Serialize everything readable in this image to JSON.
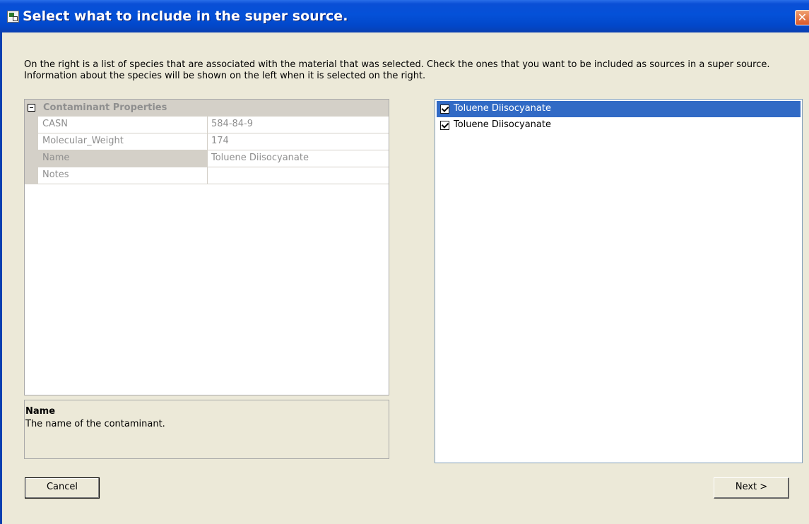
{
  "window": {
    "title": "Select what to include in the super source.",
    "close_glyph": "✕"
  },
  "instructions": "On the right is a list of species that are associated with the material that was selected.  Check the ones that you want to be included as sources in a super source.  Information about the species will be shown on the left when it is selected on the right.",
  "property_grid": {
    "category": "Contaminant Properties",
    "rows": [
      {
        "name": "CASN",
        "value": "584-84-9"
      },
      {
        "name": "Molecular_Weight",
        "value": "174"
      },
      {
        "name": "Name",
        "value": "Toluene Diisocyanate"
      },
      {
        "name": "Notes",
        "value": ""
      }
    ],
    "selected_row": "Name"
  },
  "description": {
    "title": "Name",
    "text": "The name of the contaminant."
  },
  "species_list": {
    "items": [
      {
        "label": "Toluene Diisocyanate",
        "checked": true,
        "selected": true
      },
      {
        "label": "Toluene Diisocyanate",
        "checked": true,
        "selected": false
      }
    ]
  },
  "buttons": {
    "cancel": "Cancel",
    "next": "Next >"
  },
  "colors": {
    "title_bar": "#0451d8",
    "selection": "#316ac5",
    "dialog_bg": "#ece9d8"
  }
}
